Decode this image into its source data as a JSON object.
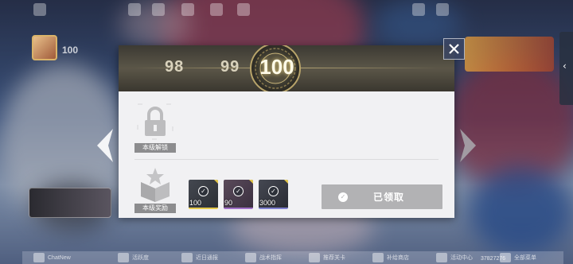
{
  "background": {
    "player_level": "100",
    "uid": "37827276",
    "bottom_bar": [
      "ChatNew",
      "活跃度",
      "近日通报",
      "战术指挥",
      "推荐关卡",
      "补给商店",
      "活动中心",
      "全部菜单"
    ]
  },
  "modal": {
    "levels": {
      "prev2": "98",
      "prev1": "99",
      "current": "100"
    },
    "unlock_section": {
      "label": "本级解锁",
      "locked": true
    },
    "reward_section": {
      "label": "本级奖励",
      "items": [
        {
          "name": "item-1",
          "quantity": "100",
          "claimed": true
        },
        {
          "name": "item-2",
          "quantity": "90",
          "claimed": true
        },
        {
          "name": "item-3",
          "quantity": "3000",
          "claimed": true
        }
      ]
    },
    "claim_button": {
      "label": "已领取",
      "state": "claimed",
      "icon": "check-circle-icon"
    },
    "close_icon": "close-icon"
  },
  "colors": {
    "header_dark": "#3c3a33",
    "panel_bg": "#f1f1f3",
    "label_gray": "#8c8c8e",
    "claimed_gray": "#b2b2b4",
    "gold_accent": "#e5c84a"
  }
}
